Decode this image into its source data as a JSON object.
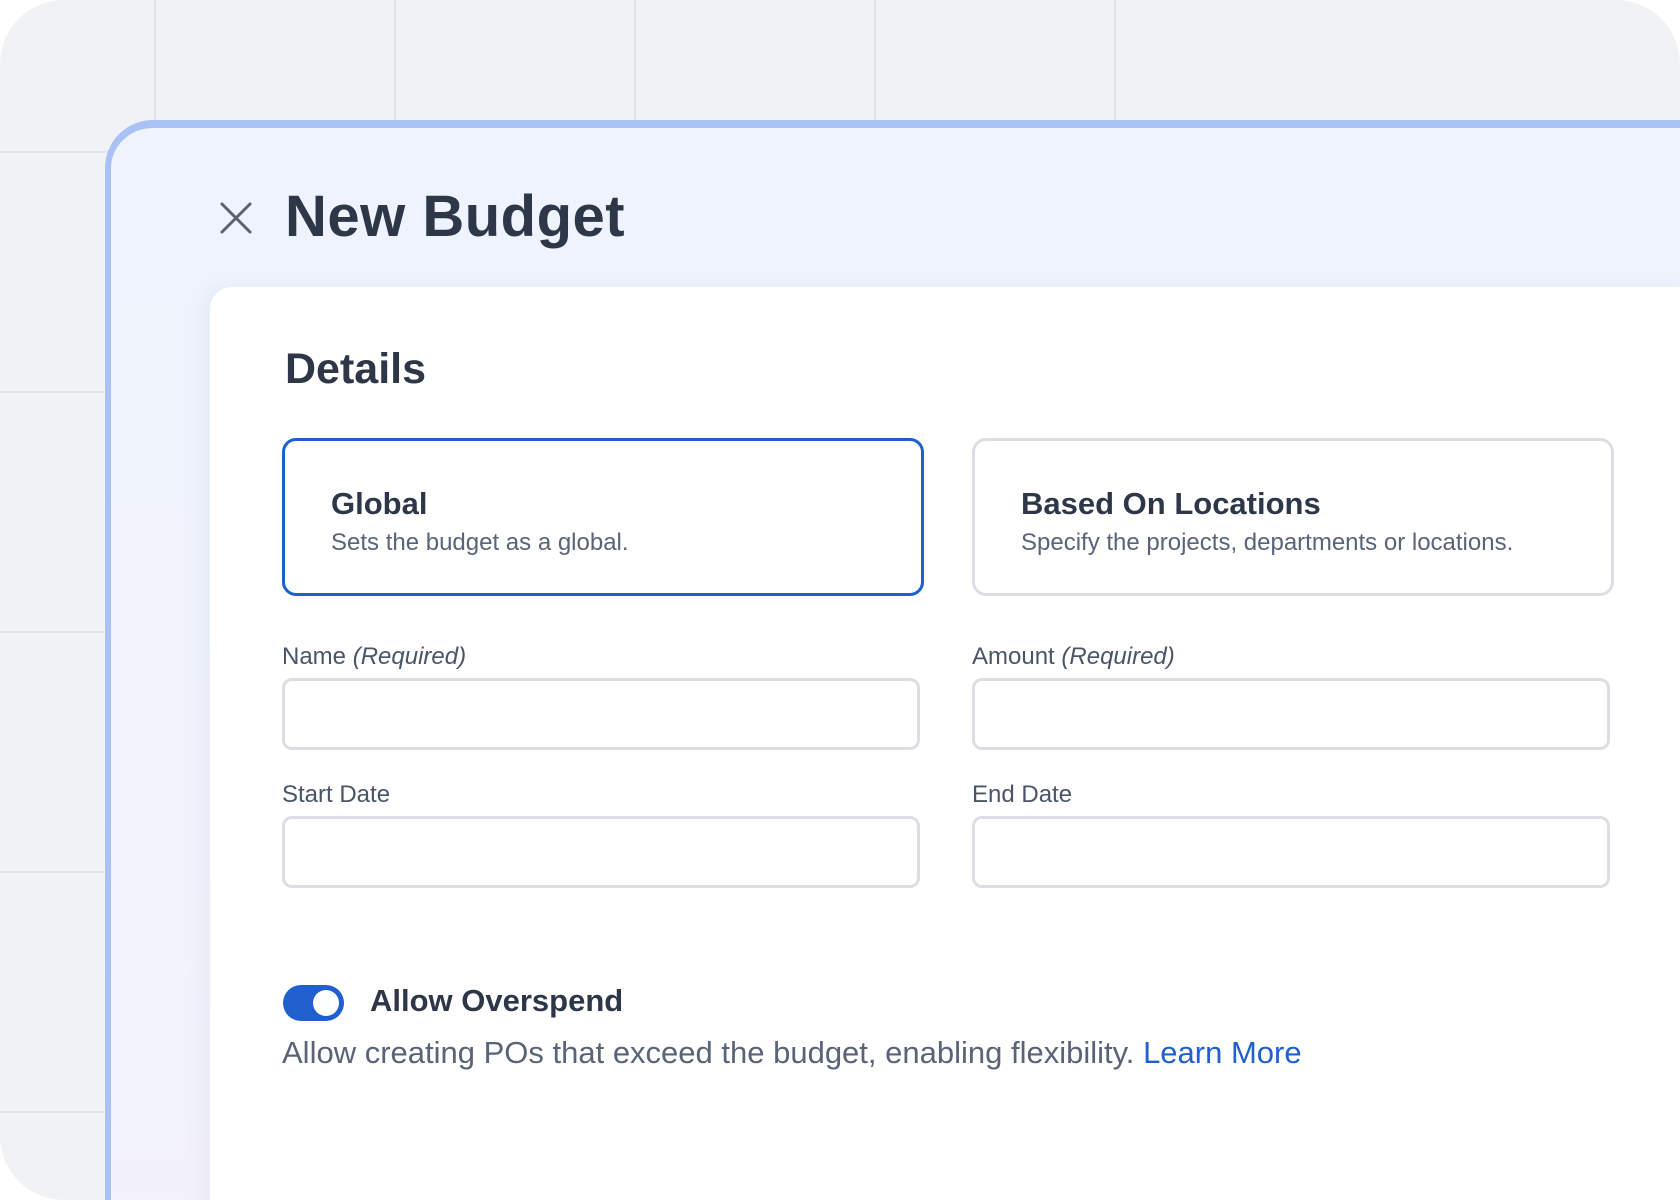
{
  "header": {
    "title": "New Budget"
  },
  "details": {
    "section_title": "Details",
    "options": [
      {
        "title": "Global",
        "description": "Sets the budget as a global.",
        "selected": true
      },
      {
        "title": "Based On Locations",
        "description": "Specify the projects, departments or locations.",
        "selected": false
      }
    ]
  },
  "fields": {
    "name": {
      "label": "Name",
      "required_note": "(Required)",
      "value": "",
      "placeholder": ""
    },
    "amount": {
      "label": "Amount",
      "required_note": "(Required)",
      "value": "",
      "placeholder": ""
    },
    "start_date": {
      "label": "Start Date",
      "value": "",
      "placeholder": ""
    },
    "end_date": {
      "label": "End Date",
      "value": "",
      "placeholder": ""
    }
  },
  "overspend": {
    "label": "Allow Overspend",
    "enabled": true,
    "help_text": "Allow creating POs that exceed the budget, enabling flexibility.",
    "link_text": "Learn More"
  },
  "icons": {
    "close": "close-icon"
  },
  "colors": {
    "accent": "#1f5fce",
    "panel_border": "#a9c1f5",
    "heading": "#2d3748",
    "muted": "#5a6478"
  }
}
